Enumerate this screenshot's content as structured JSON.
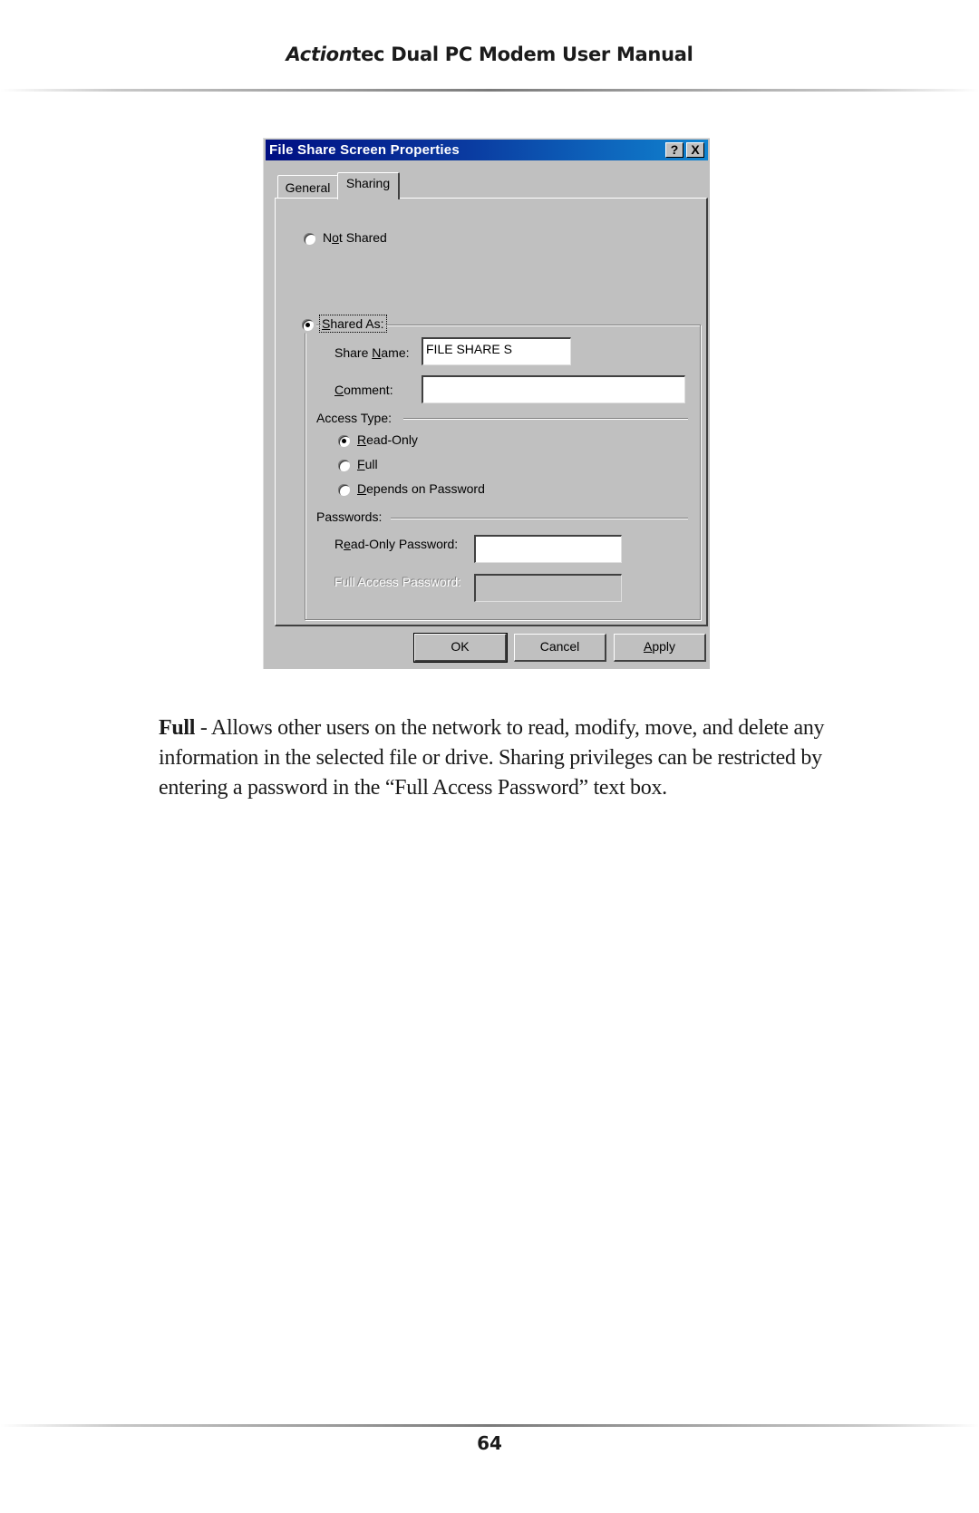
{
  "header": {
    "brand_italic": "Action",
    "brand_rest": "tec",
    "title_rest": " Dual PC Modem User Manual"
  },
  "dialog": {
    "title": "File Share Screen Properties",
    "title_buttons": {
      "help": "?",
      "close": "X"
    },
    "tabs": [
      {
        "label": "General",
        "active": false
      },
      {
        "label": "Sharing",
        "active": true
      }
    ],
    "sharing": {
      "not_shared": {
        "pre": "N",
        "accel": "o",
        "post": "t Shared",
        "checked": false
      },
      "shared_as": {
        "pre": "",
        "accel": "S",
        "post": "hared As:",
        "checked": true
      },
      "share_name": {
        "pre": "Share ",
        "accel": "N",
        "post": "ame:",
        "value": "FILE SHARE S"
      },
      "comment": {
        "pre": "",
        "accel": "C",
        "post": "omment:",
        "value": ""
      },
      "access_type_label": "Access Type:",
      "access_types": [
        {
          "pre": "",
          "accel": "R",
          "post": "ead-Only",
          "checked": true
        },
        {
          "pre": "",
          "accel": "F",
          "post": "ull",
          "checked": false
        },
        {
          "pre": "",
          "accel": "D",
          "post": "epends on Password",
          "checked": false
        }
      ],
      "passwords_label": "Passwords:",
      "read_only_password": {
        "pre": "R",
        "accel": "e",
        "post": "ad-Only Password:",
        "value": ""
      },
      "full_access_password": {
        "label": "Full Access Password:",
        "value": "",
        "disabled": true
      }
    },
    "buttons": {
      "ok": "OK",
      "cancel": "Cancel",
      "apply_accel": "A",
      "apply_rest": "pply"
    }
  },
  "body": {
    "term": "Full",
    "description": " - Allows other users on the network to read, modify, move, and delete any information in the selected file or drive. Sharing privileges can be restricted by entering a password in the “Full Access Password” text box."
  },
  "footer": {
    "page_number": "64"
  }
}
